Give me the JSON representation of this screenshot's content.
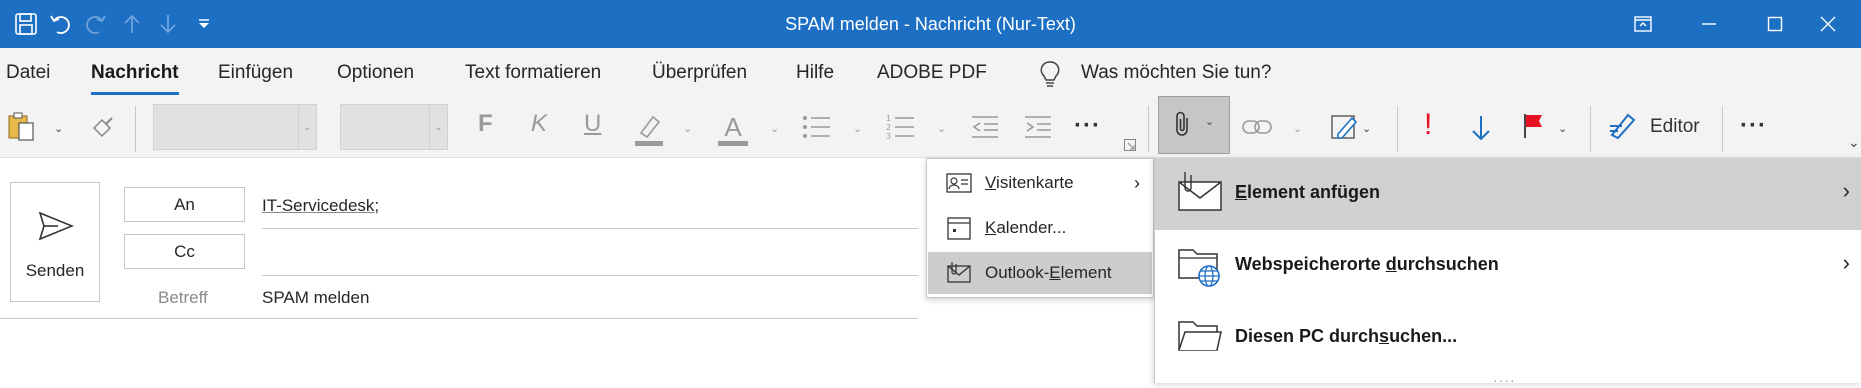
{
  "window": {
    "title": "SPAM melden  -  Nachricht (Nur-Text)"
  },
  "tabs": [
    {
      "label": "Datei"
    },
    {
      "label": "Nachricht"
    },
    {
      "label": "Einfügen"
    },
    {
      "label": "Optionen"
    },
    {
      "label": "Text formatieren"
    },
    {
      "label": "Überprüfen"
    },
    {
      "label": "Hilfe"
    },
    {
      "label": "ADOBE PDF"
    }
  ],
  "active_tab": "Nachricht",
  "tell_me": {
    "placeholder": "Was möchten Sie tun?"
  },
  "ribbon": {
    "bold_letter": "F",
    "italic_letter": "K",
    "underline_letter": "U",
    "font_color_letter": "A",
    "editor_label": "Editor",
    "more_label": "···",
    "exclamation": "!"
  },
  "compose": {
    "send_label": "Senden",
    "to_button": "An",
    "cc_button": "Cc",
    "subject_label": "Betreff",
    "to_value": "IT-Servicedesk;",
    "cc_value": "",
    "subject_value": "SPAM melden"
  },
  "attach_menu": {
    "items": [
      {
        "label_pre": "",
        "label_u": "V",
        "label_post": "isitenkarte"
      },
      {
        "label_pre": "",
        "label_u": "K",
        "label_post": "alender..."
      },
      {
        "label_pre": "Outlook-",
        "label_u": "E",
        "label_post": "lement"
      }
    ]
  },
  "attach_submenu": {
    "items": [
      {
        "label_pre": "",
        "label_u": "E",
        "label_post": "lement anfügen"
      },
      {
        "label_pre": "Webspeicherorte ",
        "label_u": "d",
        "label_post": "urchsuchen"
      },
      {
        "label_pre": "Diesen PC durch",
        "label_u": "s",
        "label_post": "uchen..."
      }
    ]
  },
  "colors": {
    "titlebar": "#1d6fc4",
    "accent_blue": "#1d6fc4",
    "flag_red": "#e81123",
    "selection_grey": "#cdcdcd"
  }
}
